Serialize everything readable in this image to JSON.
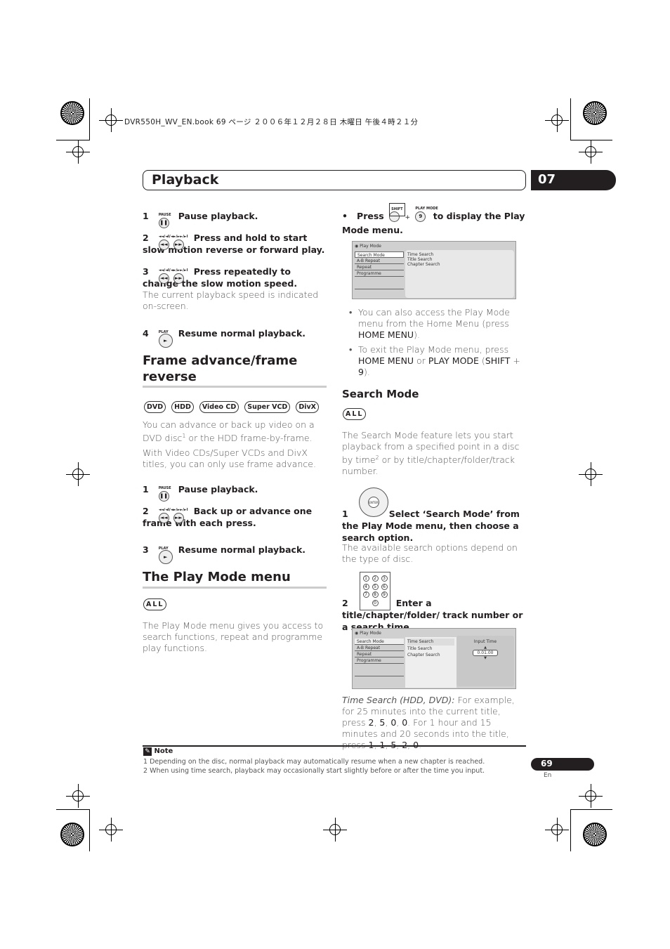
{
  "book_header": "DVR550H_WV_EN.book  69 ページ  ２００６年１２月２８日  木曜日  午後４時２１分",
  "section_title": "Playback",
  "chapter_number": "07",
  "left": {
    "steps1": [
      {
        "num": "1",
        "button_labels": [
          "PAUSE"
        ],
        "text": "Pause playback."
      },
      {
        "num": "2",
        "button_labels": [
          "◄◄/◄I/◄",
          "►/►►/►I"
        ],
        "text": "Press and hold to start slow motion reverse or forward play."
      },
      {
        "num": "3",
        "button_labels": [
          "◄◄/◄I/◄",
          "►/►►/►I"
        ],
        "text": "Press repeatedly to change the slow motion speed.",
        "desc": "The current playback speed is indicated on-screen."
      },
      {
        "num": "4",
        "button_labels": [
          "PLAY"
        ],
        "text": "Resume normal playback."
      }
    ],
    "frame_heading": "Frame advance/frame reverse",
    "disc_badges": [
      "DVD",
      "HDD",
      "Video CD",
      "Super VCD",
      "DivX"
    ],
    "frame_p1a": "You can advance or back up video on a DVD disc",
    "frame_p1_sup": "1",
    "frame_p1b": " or the HDD frame-by-frame.",
    "frame_p2": "With Video CDs/Super VCDs and DivX titles, you can only use frame advance.",
    "steps2": [
      {
        "num": "1",
        "button_labels": [
          "PAUSE"
        ],
        "text": "Pause playback."
      },
      {
        "num": "2",
        "button_labels": [
          "◄◄/◄I/◄",
          "►/►►/►I"
        ],
        "text": "Back up or advance one frame with each press."
      },
      {
        "num": "3",
        "button_labels": [
          "PLAY"
        ],
        "text": "Resume normal playback."
      }
    ],
    "playmode_heading": "The Play Mode menu",
    "all_badge": "ALL",
    "playmode_p": "The Play Mode menu gives you access to search functions, repeat and programme play functions."
  },
  "right": {
    "bullet_press": "Press",
    "shift_label": "SHIFT",
    "plus": "+",
    "playmode_label": "PLAY MODE",
    "nine": "9",
    "bullet_rest": "to display the Play Mode menu.",
    "screen1": {
      "title": "Play Mode",
      "menu": [
        "Search Mode",
        "A-B Repeat",
        "Repeat",
        "Programme"
      ],
      "options": [
        "Time Search",
        "Title Search",
        "Chapter Search"
      ]
    },
    "bullets": [
      [
        {
          "t": "You can also access the Play Mode menu from the Home Menu (press "
        },
        {
          "b": "HOME MENU"
        },
        {
          "t": ")."
        }
      ],
      [
        {
          "t": "To exit the Play Mode menu, press "
        },
        {
          "b": "HOME MENU"
        },
        {
          "t": " or "
        },
        {
          "b": "PLAY MODE"
        },
        {
          "t": " ("
        },
        {
          "b": "SHIFT"
        },
        {
          "t": " + "
        },
        {
          "b": "9"
        },
        {
          "t": ")."
        }
      ]
    ],
    "search_heading": "Search Mode",
    "all_badge": "ALL",
    "search_p_a": "The Search Mode feature lets you start playback from a specified point in a disc by time",
    "search_sup": "2",
    "search_p_b": " or by title/chapter/folder/track number.",
    "enter_label": "ENTER",
    "step1_num": "1",
    "step1_text": "Select ‘Search Mode’ from the Play Mode menu, then choose a search option.",
    "step1_desc": "The available search options depend on the type of disc.",
    "keypad": [
      "1",
      "2",
      "3",
      "4",
      "5",
      "6",
      "7",
      "8",
      "9",
      "0"
    ],
    "step2_num": "2",
    "step2_text": "Enter a title/chapter/folder/ track number or a search time.",
    "screen2": {
      "title": "Play Mode",
      "menu": [
        "Search Mode",
        "A-B Repeat",
        "Repeat",
        "Programme"
      ],
      "options": [
        "Time Search",
        "Title Search",
        "Chapter Search"
      ],
      "input_label": "Input Time",
      "input_value": "0.01.00"
    },
    "time_italic": "Time Search (HDD, DVD):",
    "time_p": [
      {
        "t": " For example, for 25 minutes into the current title, press "
      },
      {
        "b": "2"
      },
      {
        "t": ", "
      },
      {
        "b": "5"
      },
      {
        "t": ", "
      },
      {
        "b": "0"
      },
      {
        "t": ", "
      },
      {
        "b": "0"
      },
      {
        "t": ". For 1 hour and 15 minutes and 20 seconds into the title, press "
      },
      {
        "b": "1"
      },
      {
        "t": ", "
      },
      {
        "b": "1"
      },
      {
        "t": ", "
      },
      {
        "b": "5"
      },
      {
        "t": ", "
      },
      {
        "b": "2"
      },
      {
        "t": ", "
      },
      {
        "b": "0"
      },
      {
        "t": "."
      }
    ]
  },
  "note": {
    "title": "Note",
    "items": [
      "1 Depending on the disc, normal playback may automatically resume when a new chapter is reached.",
      "2 When using time search, playback may occasionally start slightly before or after the time you input."
    ]
  },
  "page_number": "69",
  "page_lang": "En"
}
